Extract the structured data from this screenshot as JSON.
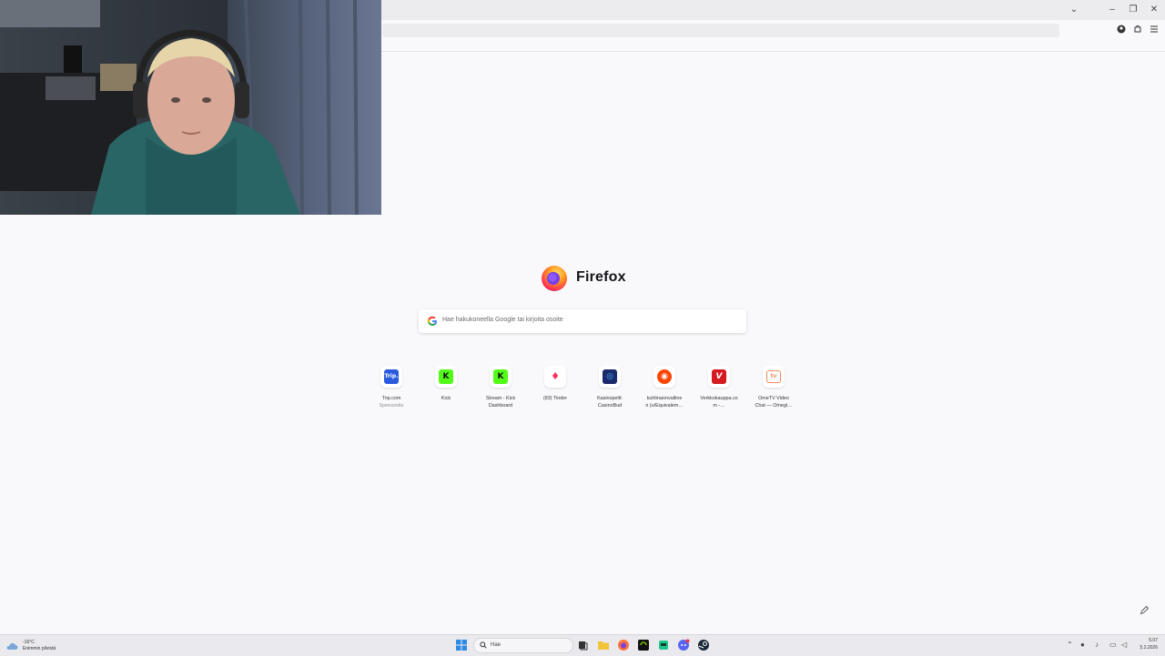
{
  "browser": {
    "name": "Firefox",
    "window_controls": {
      "chevron": "⌄",
      "minimize": "–",
      "restore": "❐",
      "close": "✕"
    },
    "toolbar_icons": [
      "account-icon",
      "extensions-icon",
      "menu-icon"
    ]
  },
  "newtab": {
    "search_placeholder": "Hae hakukoneella Google tai kirjoita osoite",
    "tiles": [
      {
        "label": "Trip.com",
        "sub": "Sponsoroitu",
        "icon": "Trip.",
        "color": "#2a5bdf",
        "name": "trip-com"
      },
      {
        "label": "Kick",
        "sub": "",
        "icon": "K",
        "color": "#53fc18",
        "name": "kick"
      },
      {
        "label": "Stream - Kick\nDashboard",
        "sub": "",
        "icon": "K",
        "color": "#53fc18",
        "name": "kick-dashboard"
      },
      {
        "label": "(83) Tinder",
        "sub": "",
        "icon": "♦",
        "color": "#fd2d5b",
        "name": "tinder"
      },
      {
        "label": "Kasinopelit:\nCasinoBud",
        "sub": "",
        "icon": "◎",
        "color": "#1a2a6c",
        "name": "casinobud"
      },
      {
        "label": "kuhlmannvalline\nn (u/Equivalem…",
        "sub": "",
        "icon": "◉",
        "color": "#ff4500",
        "name": "reddit"
      },
      {
        "label": "Verkkokauppa.co\nm -…",
        "sub": "",
        "icon": "V",
        "color": "#d71920",
        "name": "verkkokauppa"
      },
      {
        "label": "OmeTV Video\nChat — Omegl…",
        "sub": "",
        "icon": "tv",
        "color": "#f08a5d",
        "name": "ometv"
      }
    ]
  },
  "taskbar": {
    "weather_temp": "-16°C",
    "weather_desc": "Enimmin pilvistä",
    "search_label": "Hae",
    "time": "5.07",
    "date": "5.2.2026"
  }
}
